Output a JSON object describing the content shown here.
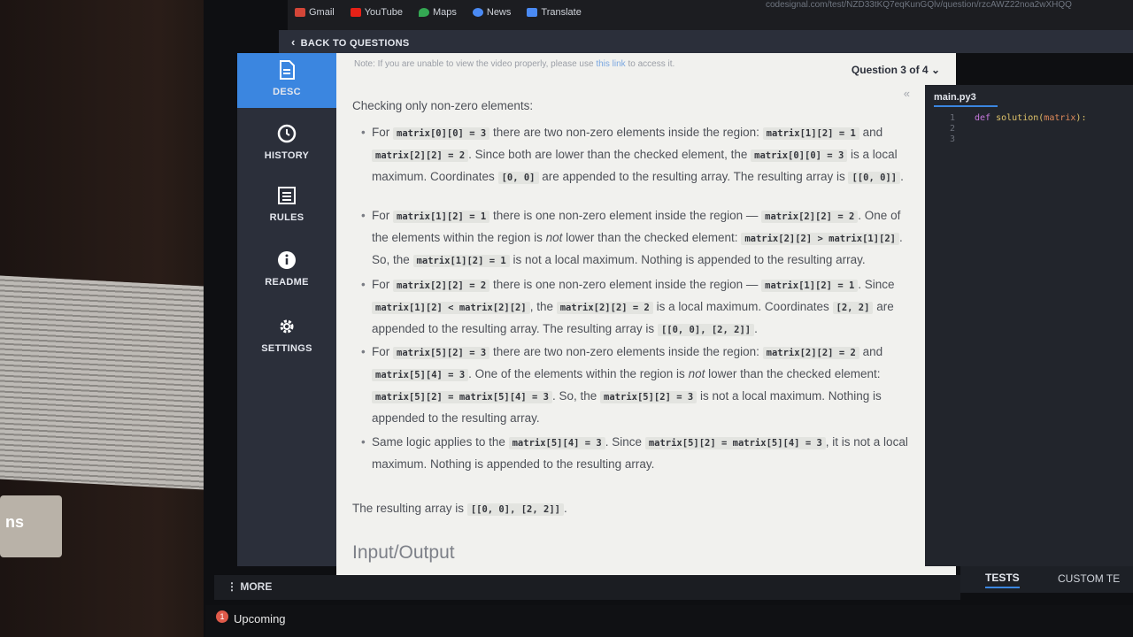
{
  "browser": {
    "url": "codesignal.com/test/NZD33tKQ7eqKunGQlv/question/rzcAWZ22noa2wXHQQ",
    "bookmarks": [
      "Gmail",
      "YouTube",
      "Maps",
      "News",
      "Translate"
    ]
  },
  "header": {
    "back_label": "BACK TO QUESTIONS"
  },
  "nav": {
    "items": [
      {
        "label": "DESC",
        "icon": "document-icon"
      },
      {
        "label": "HISTORY",
        "icon": "clock-icon"
      },
      {
        "label": "RULES",
        "icon": "list-icon"
      },
      {
        "label": "README",
        "icon": "info-icon"
      },
      {
        "label": "SETTINGS",
        "icon": "gear-icon"
      }
    ],
    "more_label": "MORE"
  },
  "question": {
    "counter": "Question 3 of 4",
    "note_prefix": "Note: If you are unable to view the video properly, please use",
    "note_link": "this link",
    "note_suffix": "to access it.",
    "collapse_glyph": "«",
    "intro": "Checking only non-zero elements:",
    "b1": {
      "t1": "For",
      "c1": "matrix[0][0] = 3",
      "t2": "there are two non-zero elements inside the region:",
      "c2": "matrix[1][2] = 1",
      "t3": "and",
      "c3": "matrix[2][2] = 2",
      "t4": ". Since both are lower than the checked element, the",
      "c4": "matrix[0][0] = 3",
      "t5": "is a local maximum. Coordinates",
      "c5": "[0, 0]",
      "t6": "are appended to the resulting array. The resulting array is",
      "c6": "[[0, 0]]",
      "t7": "."
    },
    "b2": {
      "t1": "For",
      "c1": "matrix[1][2] = 1",
      "t2": "there is one non-zero element inside the region —",
      "c2": "matrix[2][2] = 2",
      "t3": ". One of the elements within the region is",
      "em": "not",
      "t4": "lower than the checked element:",
      "c3": "matrix[2][2] > matrix[1][2]",
      "t5": ". So, the",
      "c4": "matrix[1][2] = 1",
      "t6": "is not a local maximum. Nothing is appended to the resulting array."
    },
    "b3": {
      "t1": "For",
      "c1": "matrix[2][2] = 2",
      "t2": "there is one non-zero element inside the region —",
      "c2": "matrix[1][2] = 1",
      "t3": ". Since",
      "c3": "matrix[1][2] < matrix[2][2]",
      "t4": ", the",
      "c4": "matrix[2][2] = 2",
      "t5": "is a local maximum. Coordinates",
      "c5": "[2, 2]",
      "t6": "are appended to the resulting array. The resulting array is",
      "c6": "[[0, 0], [2, 2]]",
      "t7": "."
    },
    "b4": {
      "t1": "For",
      "c1": "matrix[5][2] = 3",
      "t2": "there are two non-zero elements inside the region:",
      "c2": "matrix[2][2] = 2",
      "t3": "and",
      "c3": "matrix[5][4] = 3",
      "t4": ". One of the elements within the region is",
      "em": "not",
      "t5": "lower than the checked element:",
      "c4": "matrix[5][2] = matrix[5][4] = 3",
      "t6": ". So, the",
      "c5": "matrix[5][2] = 3",
      "t7": "is not a local maximum. Nothing is appended to the resulting array."
    },
    "b5": {
      "t1": "Same logic applies to the",
      "c1": "matrix[5][4] = 3",
      "t2": ". Since",
      "c2": "matrix[5][2] = matrix[5][4] = 3",
      "t3": ", it is not a local maximum. Nothing is appended to the resulting array."
    },
    "result": {
      "t1": "The resulting array is",
      "c1": "[[0, 0], [2, 2]]",
      "t2": "."
    },
    "io_heading": "Input/Output"
  },
  "editor": {
    "filename": "main.py3",
    "line_numbers": [
      "1",
      "2",
      "3"
    ],
    "kw": "def",
    "fn": "solution",
    "arg": "matrix"
  },
  "bottom": {
    "tests_tab": "TESTS",
    "custom_tab": "CUSTOM TE"
  },
  "taskbar": {
    "upcoming_label": "Upcoming",
    "upcoming_badge": "1"
  },
  "desk": {
    "box_text": "ns"
  }
}
